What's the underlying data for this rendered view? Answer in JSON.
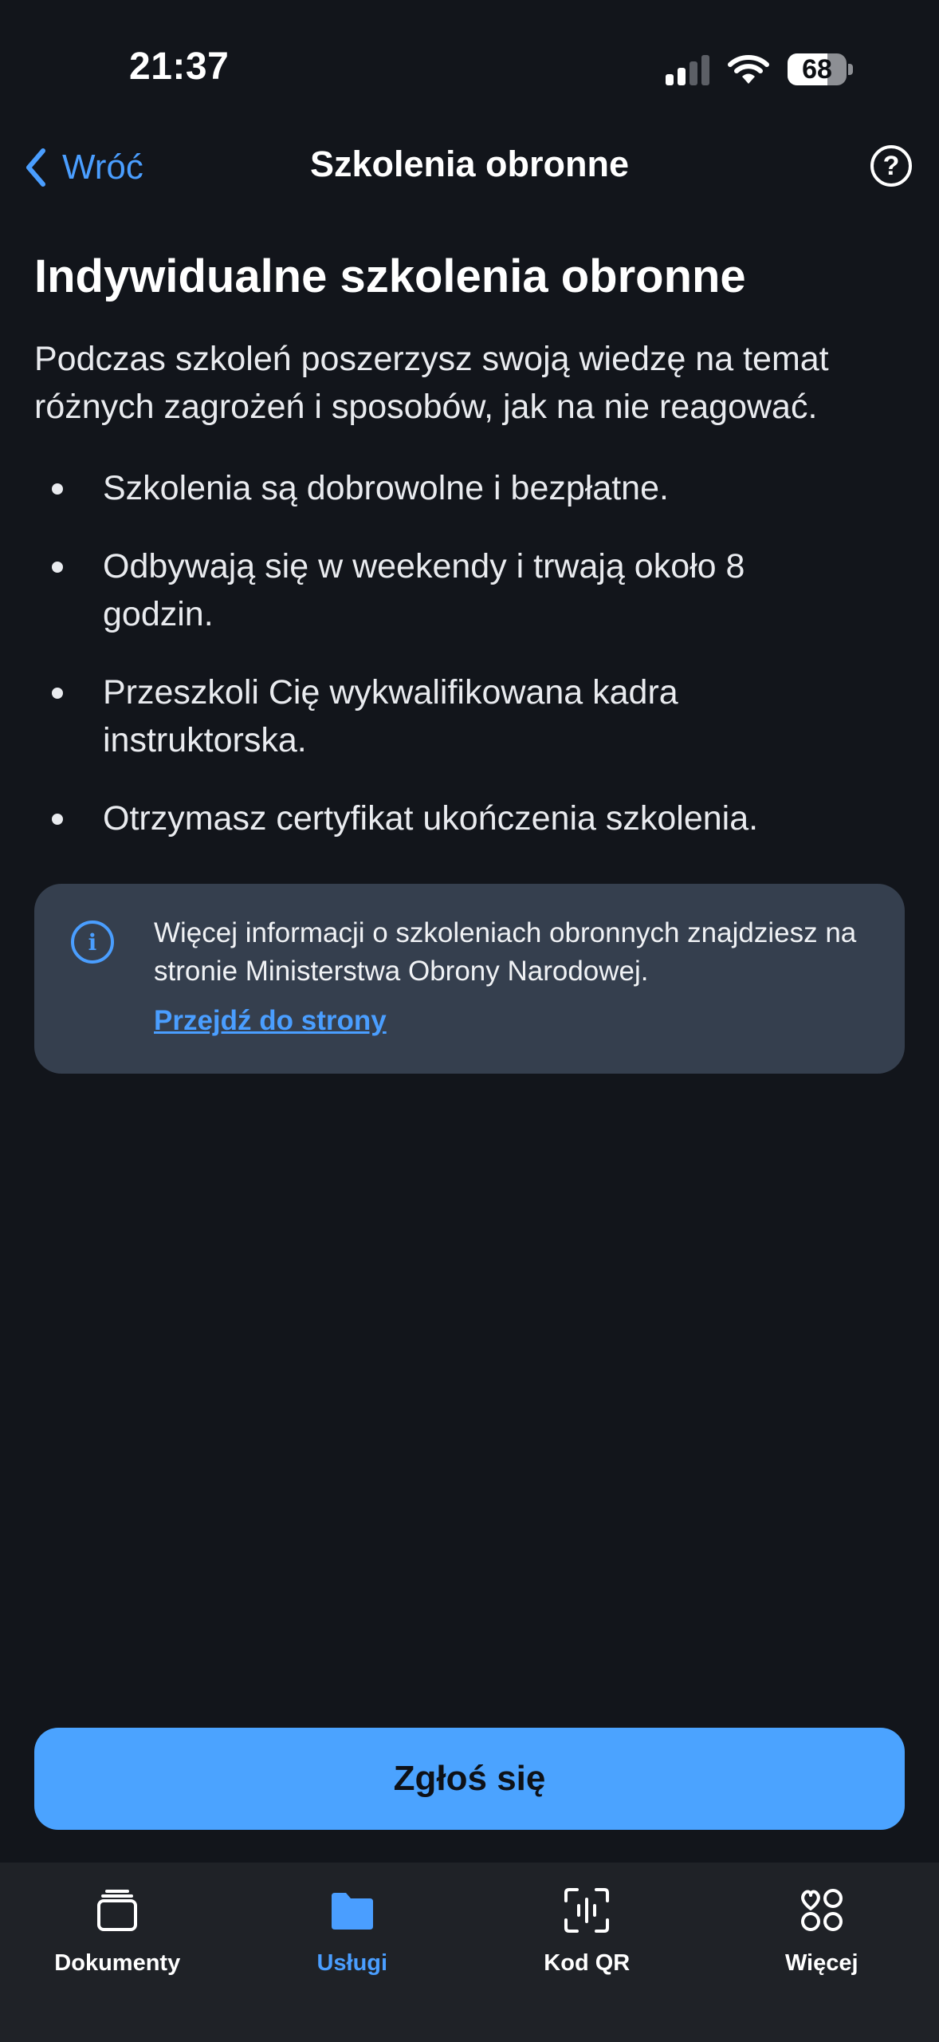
{
  "status_bar": {
    "time": "21:37",
    "battery_percent": "68",
    "battery_level": 0.68,
    "signal_bars_active": 2,
    "signal_bars_total": 4
  },
  "nav": {
    "back_label": "Wróć",
    "title": "Szkolenia obronne",
    "help_icon": "question-circle-icon"
  },
  "content": {
    "heading": "Indywidualne szkolenia obronne",
    "intro": "Podczas szkoleń poszerzysz swoją wiedzę na temat różnych zagrożeń i sposobów, jak na nie reagować.",
    "bullets": [
      "Szkolenia są dobrowolne i bezpłatne.",
      "Odbywają się w weekendy i trwają około 8 godzin.",
      "Przeszkoli Cię wykwalifikowana kadra instruktorska.",
      "Otrzymasz certyfikat ukończenia szkolenia."
    ]
  },
  "info_card": {
    "icon": "info-icon",
    "text": "Więcej informacji o szkoleniach obronnych znajdziesz na stronie Ministerstwa Obrony Narodowej.",
    "link_label": "Przejdź do strony"
  },
  "primary_button": {
    "label": "Zgłoś się"
  },
  "tabbar": {
    "tabs": [
      {
        "label": "Dokumenty",
        "icon": "documents-stack-icon",
        "active": false
      },
      {
        "label": "Usługi",
        "icon": "folder-icon",
        "active": true
      },
      {
        "label": "Kod QR",
        "icon": "qr-scan-icon",
        "active": false
      },
      {
        "label": "Więcej",
        "icon": "more-grid-icon",
        "active": false
      }
    ]
  },
  "colors": {
    "background": "#12151b",
    "accent": "#4a9eff",
    "button": "#4ba3ff",
    "card": "#353f4e",
    "tabbar": "#1f2227"
  }
}
